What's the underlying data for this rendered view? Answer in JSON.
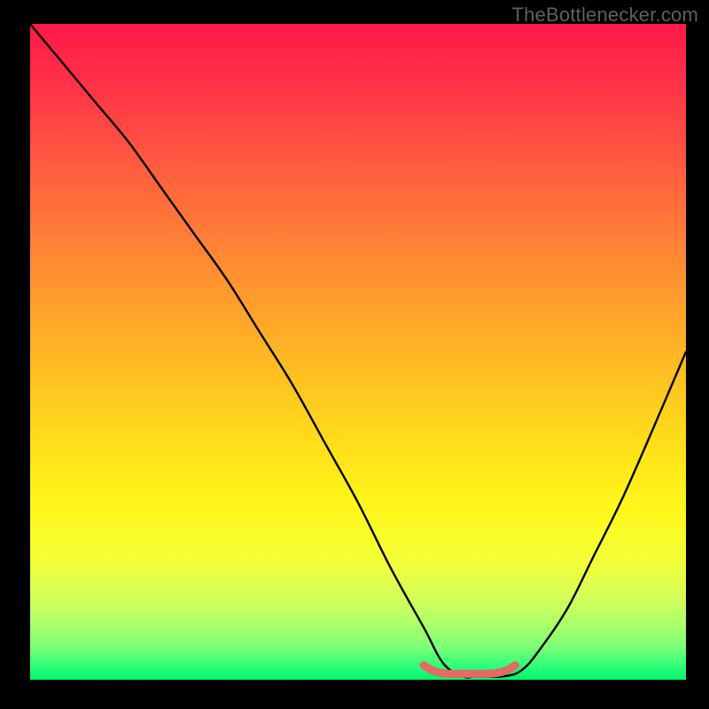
{
  "watermark": "TheBottlenecker.com",
  "chart_data": {
    "type": "line",
    "title": "",
    "xlabel": "",
    "ylabel": "",
    "xlim": [
      0,
      100
    ],
    "ylim": [
      0,
      100
    ],
    "series": [
      {
        "name": "bottleneck-curve",
        "x": [
          0,
          5,
          10,
          15,
          20,
          25,
          30,
          35,
          40,
          45,
          50,
          55,
          60,
          63,
          66,
          68,
          72,
          75,
          78,
          82,
          86,
          90,
          94,
          100
        ],
        "values": [
          100,
          94,
          88,
          82,
          75,
          68,
          61,
          53,
          45,
          36,
          27,
          17,
          8,
          2.5,
          0.5,
          0.5,
          0.5,
          1.5,
          5,
          11,
          19,
          27,
          36,
          50
        ]
      },
      {
        "name": "optimal-range-marker",
        "x": [
          60,
          61,
          62,
          63,
          64,
          66,
          68,
          70,
          71,
          72,
          73,
          74
        ],
        "values": [
          2.2,
          1.6,
          1.2,
          1.0,
          0.9,
          0.9,
          0.9,
          0.9,
          1.0,
          1.2,
          1.6,
          2.2
        ]
      }
    ],
    "gradient_stops": [
      {
        "pos": 0,
        "color": "#ff1948"
      },
      {
        "pos": 50,
        "color": "#ffb524"
      },
      {
        "pos": 74,
        "color": "#fff81a"
      },
      {
        "pos": 100,
        "color": "#00f56a"
      }
    ]
  }
}
